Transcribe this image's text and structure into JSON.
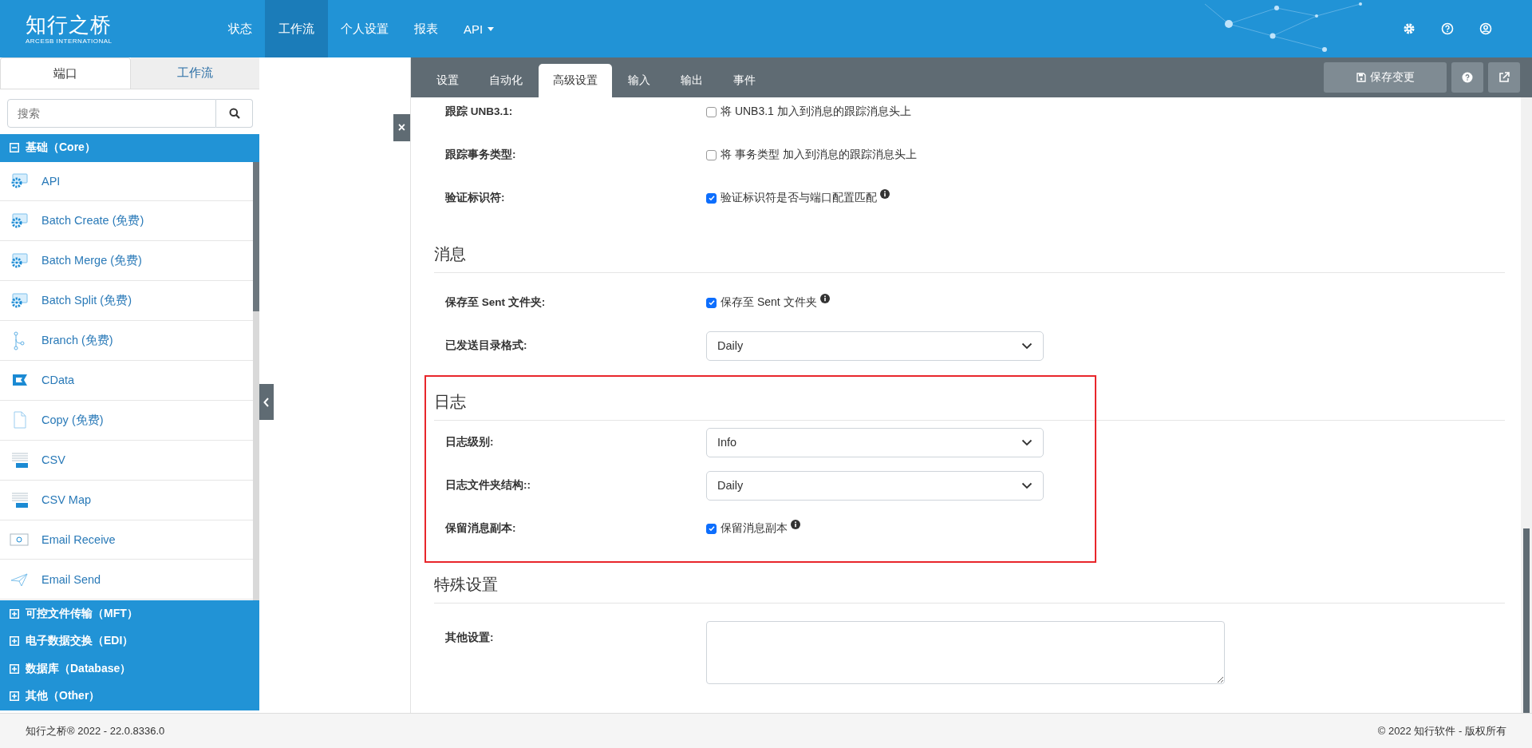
{
  "header": {
    "logo": {
      "title": "知行之桥",
      "subtitle": "ARCESB INTERNATIONAL"
    },
    "nav": [
      {
        "label": "状态",
        "selected": false,
        "dropdown": false
      },
      {
        "label": "工作流",
        "selected": true,
        "dropdown": false
      },
      {
        "label": "个人设置",
        "selected": false,
        "dropdown": false
      },
      {
        "label": "报表",
        "selected": false,
        "dropdown": false
      },
      {
        "label": "API",
        "selected": false,
        "dropdown": true
      }
    ]
  },
  "sidebar": {
    "tabs": [
      {
        "label": "端口",
        "selected": true
      },
      {
        "label": "工作流",
        "selected": false
      }
    ],
    "search": {
      "placeholder": "搜索"
    },
    "groups": [
      {
        "label": "基础（Core）",
        "expanded": true,
        "items": [
          "API",
          "Batch Create (免费)",
          "Batch Merge (免费)",
          "Batch Split (免费)",
          "Branch (免费)",
          "CData",
          "Copy (免费)",
          "CSV",
          "CSV Map",
          "Email Receive",
          "Email Send"
        ]
      },
      {
        "label": "可控文件传输（MFT）",
        "expanded": false
      },
      {
        "label": "电子数据交换（EDI）",
        "expanded": false
      },
      {
        "label": "数据库（Database）",
        "expanded": false
      },
      {
        "label": "其他（Other）",
        "expanded": false
      }
    ]
  },
  "close_button": "×",
  "panel": {
    "tabs": [
      {
        "label": "设置",
        "selected": false
      },
      {
        "label": "自动化",
        "selected": false
      },
      {
        "label": "高级设置",
        "selected": true
      },
      {
        "label": "输入",
        "selected": false
      },
      {
        "label": "输出",
        "selected": false
      },
      {
        "label": "事件",
        "selected": false
      }
    ],
    "save_button": "保存变更",
    "sections": [
      {
        "highlighted": false,
        "rows": [
          {
            "label": "跟踪 UNB3.1:",
            "kind": "checkbox",
            "text": "将 UNB3.1 加入到消息的跟踪消息头上",
            "checked": false,
            "info": false
          },
          {
            "label": "跟踪事务类型:",
            "kind": "checkbox",
            "text": "将 事务类型 加入到消息的跟踪消息头上",
            "checked": false,
            "info": false
          },
          {
            "label": "验证标识符:",
            "kind": "checkbox",
            "text": "验证标识符是否与端口配置匹配",
            "checked": true,
            "info": true
          }
        ]
      },
      {
        "title": "消息",
        "highlighted": false,
        "rows": [
          {
            "label": "保存至 Sent 文件夹:",
            "kind": "checkbox",
            "text": "保存至 Sent 文件夹",
            "checked": true,
            "info": true
          },
          {
            "label": "已发送目录格式:",
            "kind": "select",
            "value": "Daily"
          }
        ]
      },
      {
        "title": "日志",
        "highlighted": true,
        "rows": [
          {
            "label": "日志级别:",
            "kind": "select",
            "value": "Info"
          },
          {
            "label": "日志文件夹结构::",
            "kind": "select",
            "value": "Daily"
          },
          {
            "label": "保留消息副本:",
            "kind": "checkbox",
            "text": "保留消息副本",
            "checked": true,
            "info": true
          }
        ]
      },
      {
        "title": "特殊设置",
        "highlighted": false,
        "rows": [
          {
            "label": "其他设置:",
            "kind": "textarea"
          }
        ]
      }
    ]
  },
  "footer": {
    "left": "知行之桥® 2022 - 22.0.8336.0",
    "right": "© 2022 知行软件 - 版权所有"
  }
}
